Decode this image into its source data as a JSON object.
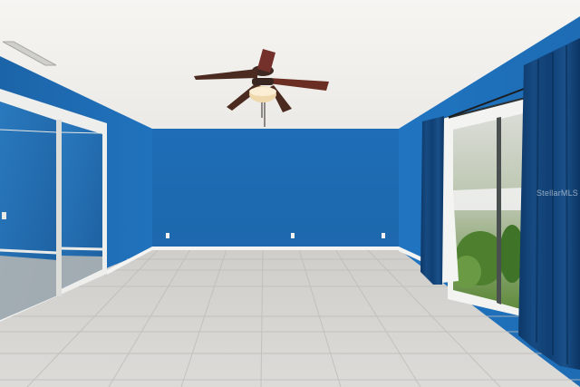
{
  "watermark": {
    "text": "StellarMLS"
  },
  "colors": {
    "wall": "#1f6fb6",
    "ceiling": "#f2f1ee",
    "floor": "#d6d5d2",
    "curtain": "#103f73",
    "baseboard": "#f4f4f2"
  },
  "icons": {
    "fan": "ceiling-fan-icon",
    "vent": "air-vent-icon",
    "outlet": "wall-outlet-icon"
  }
}
